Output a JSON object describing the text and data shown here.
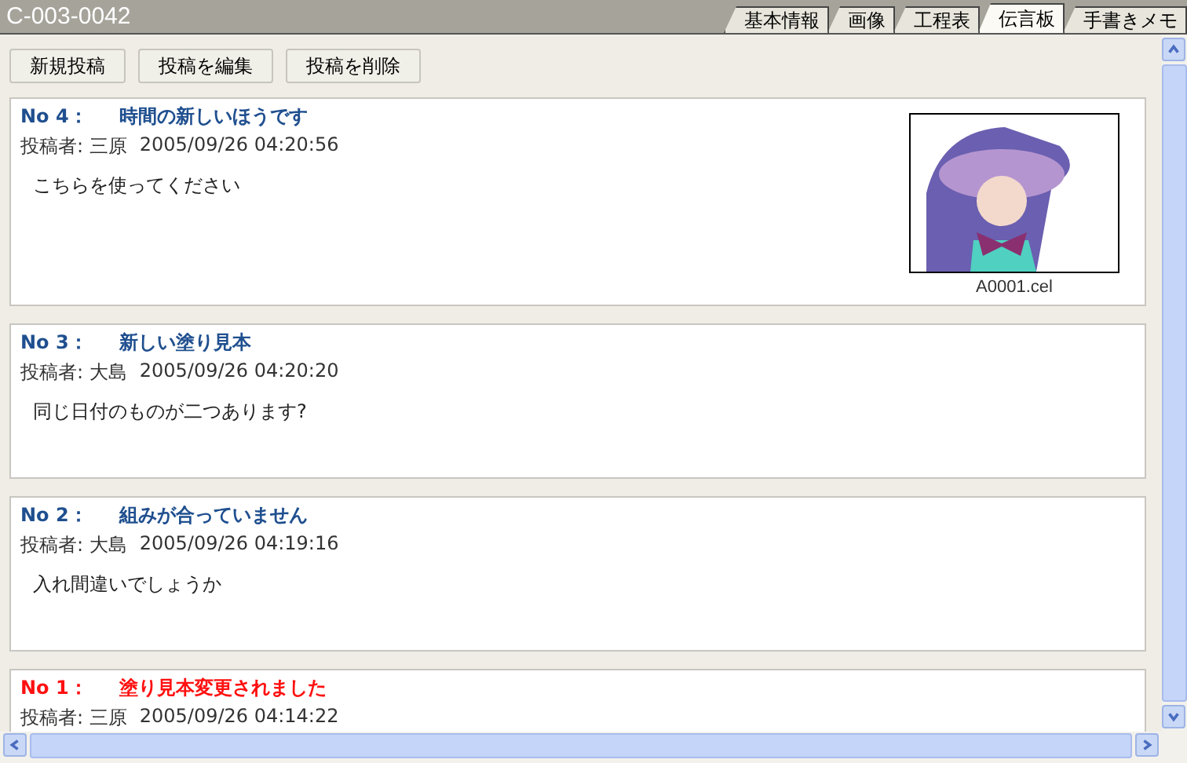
{
  "window": {
    "title": "C-003-0042"
  },
  "tabs": [
    {
      "label": "基本情報",
      "selected": false
    },
    {
      "label": "画像",
      "selected": false
    },
    {
      "label": "工程表",
      "selected": false
    },
    {
      "label": "伝言板",
      "selected": true
    },
    {
      "label": "手書きメモ",
      "selected": false
    }
  ],
  "toolbar": [
    "新規投稿",
    "投稿を編集",
    "投稿を削除"
  ],
  "posts": [
    {
      "number": "No 4：",
      "title": "時間の新しいほうです",
      "color": "#1f4f8f",
      "poster": "投稿者: 三原",
      "date": "2005/09/26 04:20:56",
      "body": "こちらを使ってください",
      "attachment": {
        "caption": "A0001.cel"
      }
    },
    {
      "number": "No 3：",
      "title": "新しい塗り見本",
      "color": "#1f4f8f",
      "poster": "投稿者: 大島",
      "date": "2005/09/26 04:20:20",
      "body": "同じ日付のものが二つあります?"
    },
    {
      "number": "No 2：",
      "title": "組みが合っていません",
      "color": "#1f4f8f",
      "poster": "投稿者: 大島",
      "date": "2005/09/26 04:19:16",
      "body": "入れ間違いでしょうか"
    },
    {
      "number": "No 1：",
      "title": "塗り見本変更されました",
      "color": "#ff1010",
      "poster": "投稿者: 三原",
      "date": "2005/09/26 04:14:22"
    }
  ]
}
